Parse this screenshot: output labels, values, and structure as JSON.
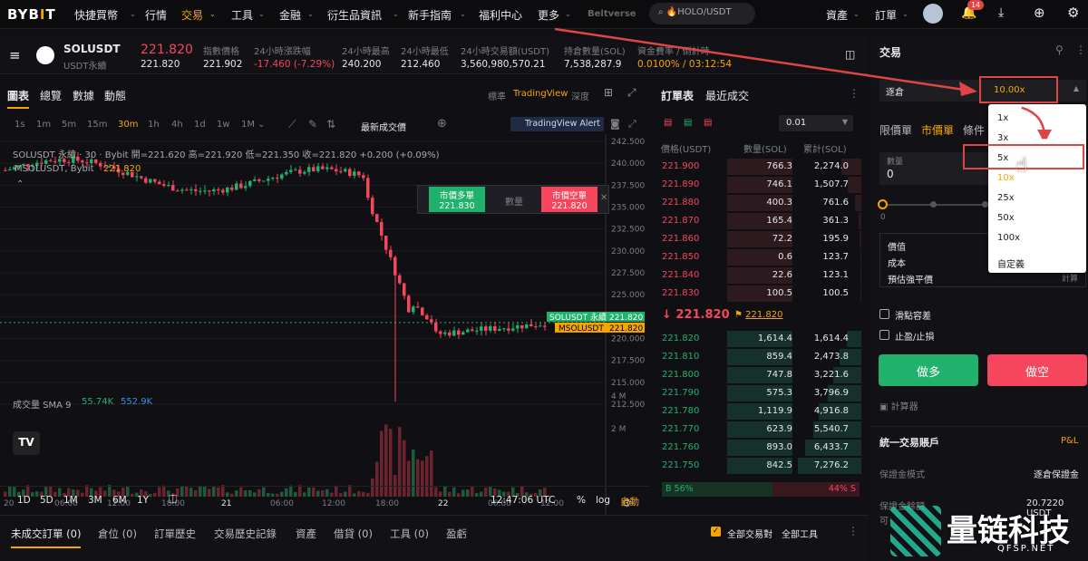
{
  "nav": {
    "logo": "BYBIT",
    "menu": [
      "快捷買幣",
      "行情",
      "交易",
      "工具",
      "金融",
      "衍生品資訊",
      "新手指南",
      "福利中心",
      "更多",
      "Beltverse"
    ],
    "search": "🔥HOLO/USDT",
    "right": [
      "資產",
      "訂單"
    ],
    "notif": "14"
  },
  "ticker": {
    "symbol": "SOLUSDT",
    "sub": "USDT永續",
    "price": "221.820",
    "price2": "221.820",
    "stats": [
      [
        "指數價格",
        "221.902"
      ],
      [
        "24小時漲跌幅",
        "-17.460 (-7.29%)"
      ],
      [
        "24小時最高",
        "240.200"
      ],
      [
        "24小時最低",
        "212.460"
      ],
      [
        "24小時交易額(USDT)",
        "3,560,980,570.21"
      ],
      [
        "持倉數量(SOL)",
        "7,538,287.9"
      ],
      [
        "資金費率 / 倒計時",
        "0.0100% / 03:12:54"
      ]
    ]
  },
  "chart": {
    "tabs": [
      "圖表",
      "總覽",
      "數據",
      "動態"
    ],
    "modes": [
      "標準",
      "TradingView",
      "深度"
    ],
    "intervals": [
      "1s",
      "1m",
      "5m",
      "15m",
      "30m",
      "1h",
      "4h",
      "1d",
      "1w",
      "1M"
    ],
    "latest": "最新成交價",
    "alert": "TradingView Alert",
    "legend1": "SOLUSDT 永續 · 30 · Bybit  開=221.620 高=221.920 低=221.350 收=221.820 +0.200 (+0.09%)",
    "legend2": "MSOLUSDT, Bybit",
    "legend2v": "221.820",
    "buy": "市價多單",
    "buyp": "221.830",
    "sell": "市價空單",
    "sellp": "221.820",
    "qty": "數量",
    "yticks": [
      "242.500",
      "240.000",
      "237.500",
      "235.000",
      "232.500",
      "230.000",
      "227.500",
      "225.000",
      "222.500",
      "220.000",
      "217.500",
      "215.000",
      "212.500"
    ],
    "tag1": "SOLUSDT 永續",
    "tag1v": "221.820",
    "tag2": "MSOLUSDT",
    "tag2v": "221.820",
    "volume": "成交量 SMA 9",
    "vol1": "55.74K",
    "vol2": "552.9K",
    "vticks": [
      "4 M",
      "2 M"
    ],
    "xticks": [
      "20",
      "06:00",
      "12:00",
      "18:00",
      "21",
      "06:00",
      "12:00",
      "18:00",
      "22",
      "06:00",
      "12:00"
    ],
    "ranges": [
      "1D",
      "5D",
      "1M",
      "3M",
      "6M",
      "1Y"
    ],
    "time": "12:47:06 UTC",
    "pct": "%",
    "log": "log",
    "auto": "自動"
  },
  "chart_data": {
    "type": "candlestick",
    "symbol": "SOLUSDT",
    "interval": "30m",
    "ylim": [
      212.5,
      242.5
    ],
    "last": 221.82
  },
  "orderbook": {
    "tabs": [
      "訂單表",
      "最近成交"
    ],
    "step": "0.01",
    "headers": [
      "價格(USDT)",
      "數量(SOL)",
      "累計(SOL)"
    ],
    "asks": [
      [
        "221.900",
        "766.3",
        "2,274.0"
      ],
      [
        "221.890",
        "746.1",
        "1,507.7"
      ],
      [
        "221.880",
        "400.3",
        "761.6"
      ],
      [
        "221.870",
        "165.4",
        "361.3"
      ],
      [
        "221.860",
        "72.2",
        "195.9"
      ],
      [
        "221.850",
        "0.6",
        "123.7"
      ],
      [
        "221.840",
        "22.6",
        "123.1"
      ],
      [
        "221.830",
        "100.5",
        "100.5"
      ]
    ],
    "mid": "221.820",
    "mark": "221.820",
    "bids": [
      [
        "221.820",
        "1,614.4",
        "1,614.4"
      ],
      [
        "221.810",
        "859.4",
        "2,473.8"
      ],
      [
        "221.800",
        "747.8",
        "3,221.6"
      ],
      [
        "221.790",
        "575.3",
        "3,796.9"
      ],
      [
        "221.780",
        "1,119.9",
        "4,916.8"
      ],
      [
        "221.770",
        "623.9",
        "5,540.7"
      ],
      [
        "221.760",
        "893.0",
        "6,433.7"
      ],
      [
        "221.750",
        "842.5",
        "7,276.2"
      ]
    ],
    "buypct": "56%",
    "sellpct": "44%"
  },
  "trade": {
    "title": "交易",
    "mode": "逐倉",
    "lev": "10.00x",
    "types": [
      "限價單",
      "市價單",
      "條件"
    ],
    "qty": "數量",
    "qtyv": "0",
    "slider0": "0",
    "info": [
      "價值",
      "成本",
      "預估強平價"
    ],
    "calc": "計算",
    "slip": "滑點容差",
    "tpsl": "止盈/止損",
    "long": "做多",
    "short": "做空",
    "calculator": "計算器",
    "acct": "統一交易賬戶",
    "pl": "P&L",
    "margin": "保證金模式",
    "marginv": "逐倉保證金",
    "bal": "保證金餘額",
    "balv": "20.7220 USDT",
    "avail": "可"
  },
  "levopts": [
    "1x",
    "3x",
    "5x",
    "10x",
    "25x",
    "50x",
    "100x",
    "自定義"
  ],
  "bottom": {
    "tabs": [
      "未成交訂單 (0)",
      "倉位 (0)",
      "訂單歷史",
      "交易歷史記錄",
      "資產",
      "借貸 (0)",
      "工具 (0)",
      "盈虧"
    ],
    "all": "全部交易對",
    "tools": "全部工具"
  },
  "watermark": {
    "cn": "量链科技",
    "url": "QFSP.NET"
  }
}
